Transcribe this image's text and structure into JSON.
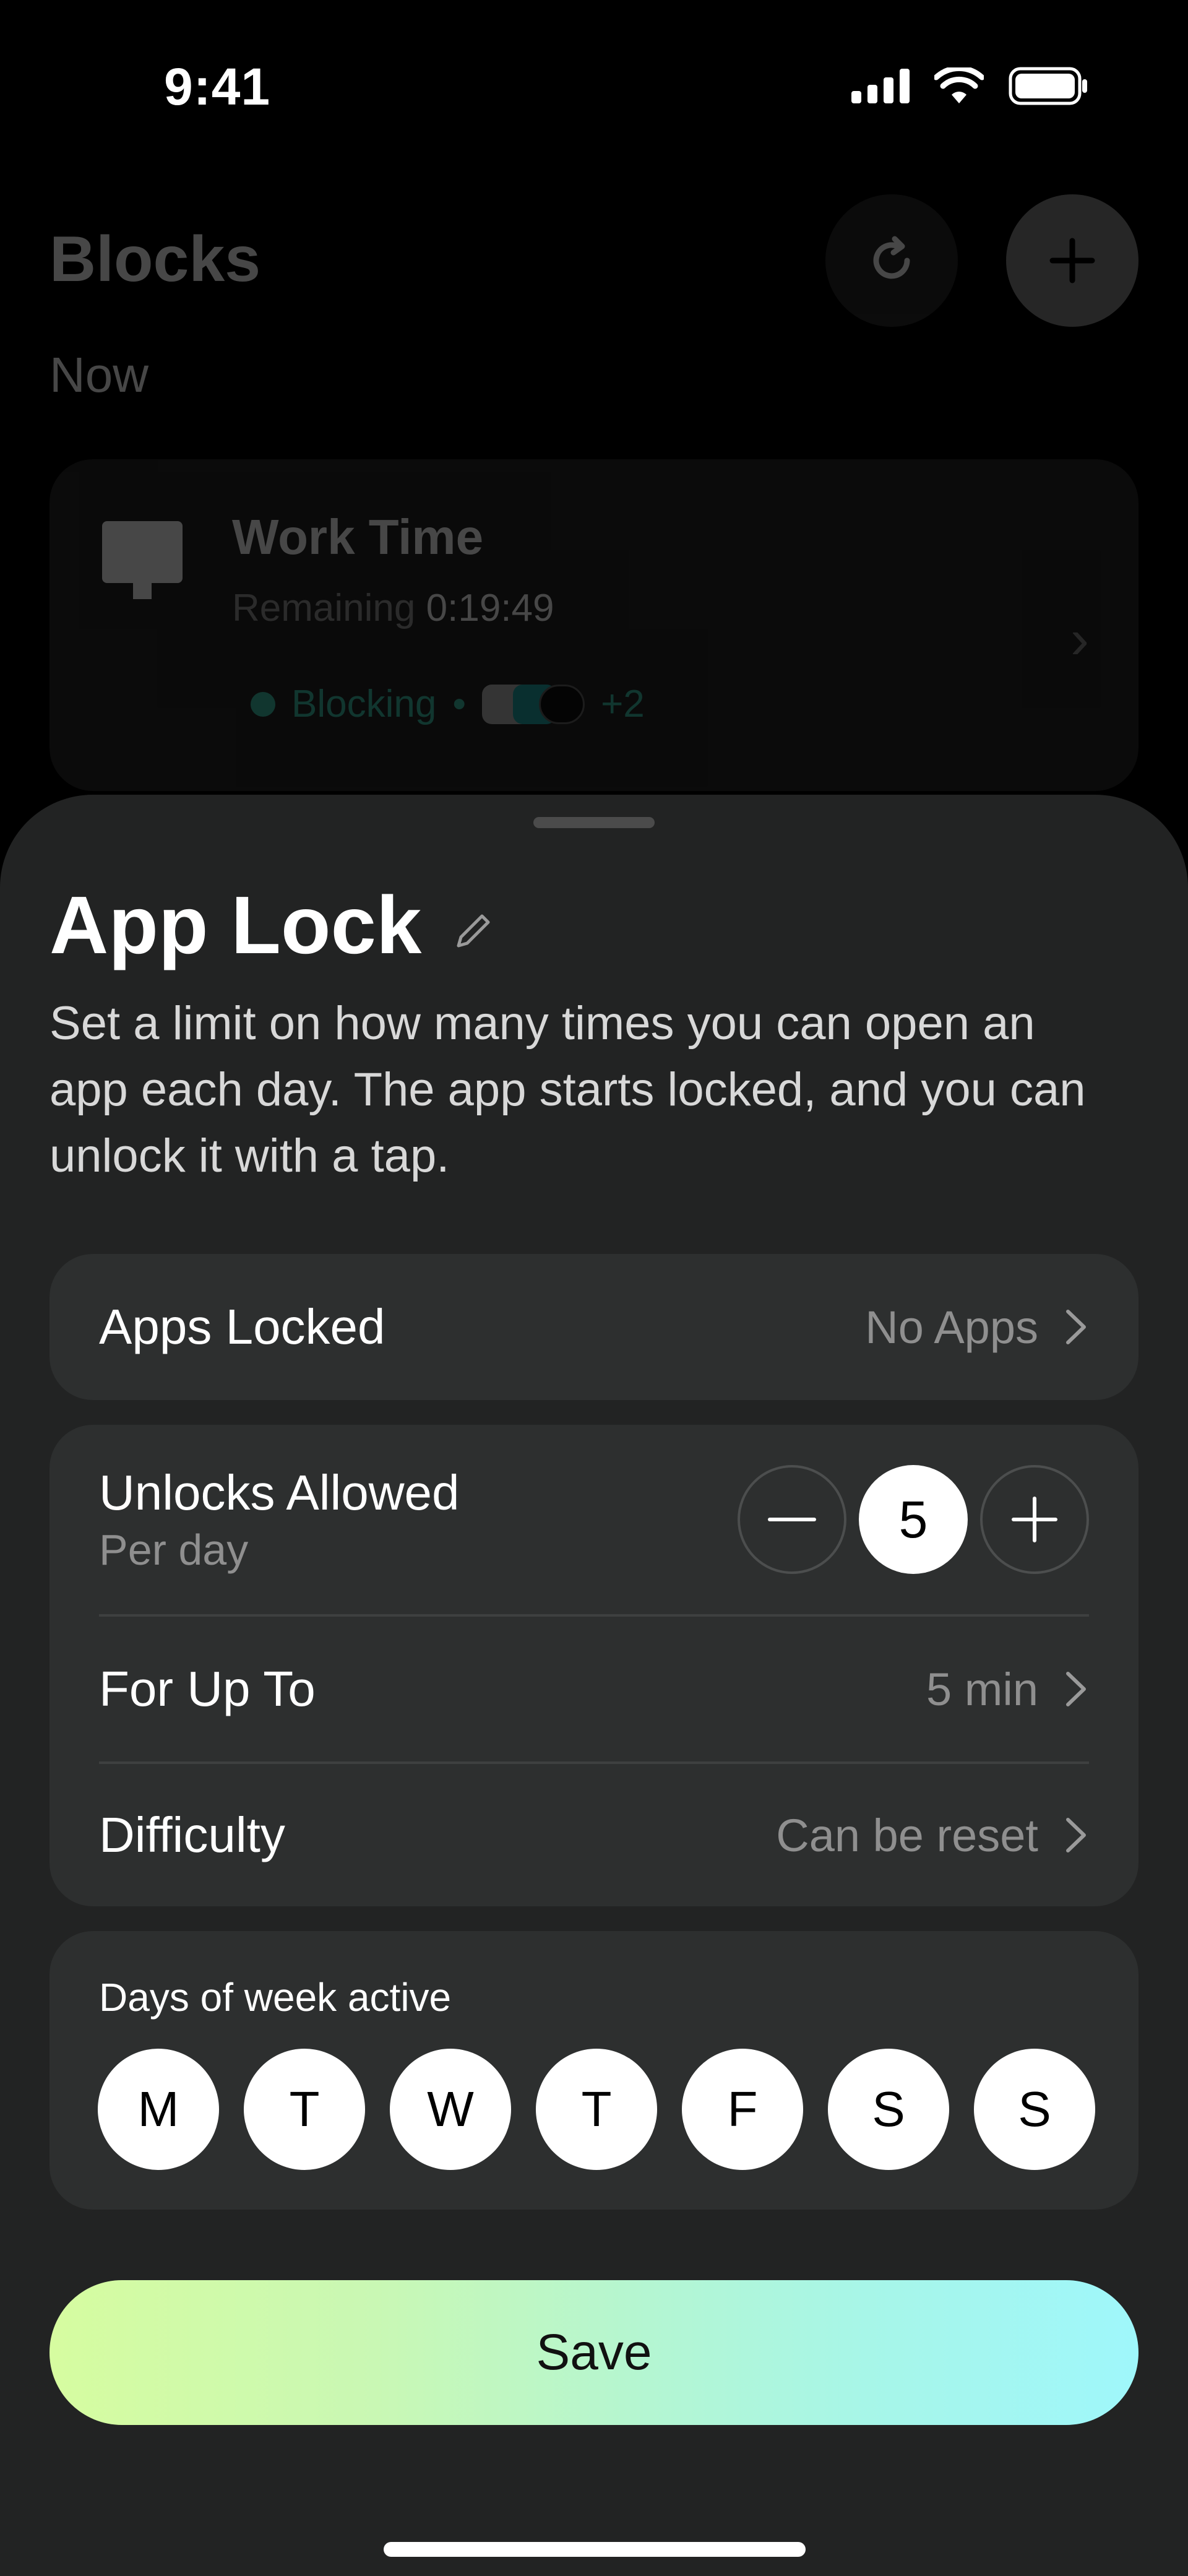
{
  "status_bar": {
    "time": "9:41"
  },
  "background": {
    "title": "Blocks",
    "section": "Now",
    "card": {
      "title": "Work Time",
      "remaining_label": "Remaining",
      "remaining_value": "0:19:49",
      "status": "Blocking",
      "extra_apps": "+2"
    }
  },
  "sheet": {
    "title": "App Lock",
    "description": "Set a limit on how many times you can open an app each day. The app starts locked, and you can unlock it with a tap.",
    "apps_locked": {
      "label": "Apps Locked",
      "value": "No Apps"
    },
    "unlocks": {
      "label": "Unlocks Allowed",
      "sub": "Per day",
      "value": "5"
    },
    "for_up_to": {
      "label": "For Up To",
      "value": "5 min"
    },
    "difficulty": {
      "label": "Difficulty",
      "value": "Can be reset"
    },
    "days": {
      "title": "Days of week active",
      "items": [
        "M",
        "T",
        "W",
        "T",
        "F",
        "S",
        "S"
      ]
    },
    "save_label": "Save"
  },
  "colors": {
    "sheet_bg": "#222323",
    "card_bg": "#2d2f2f",
    "accent_teal": "#3fc1a8",
    "save_gradient_start": "#d6fca0",
    "save_gradient_end": "#9ff7fb"
  }
}
